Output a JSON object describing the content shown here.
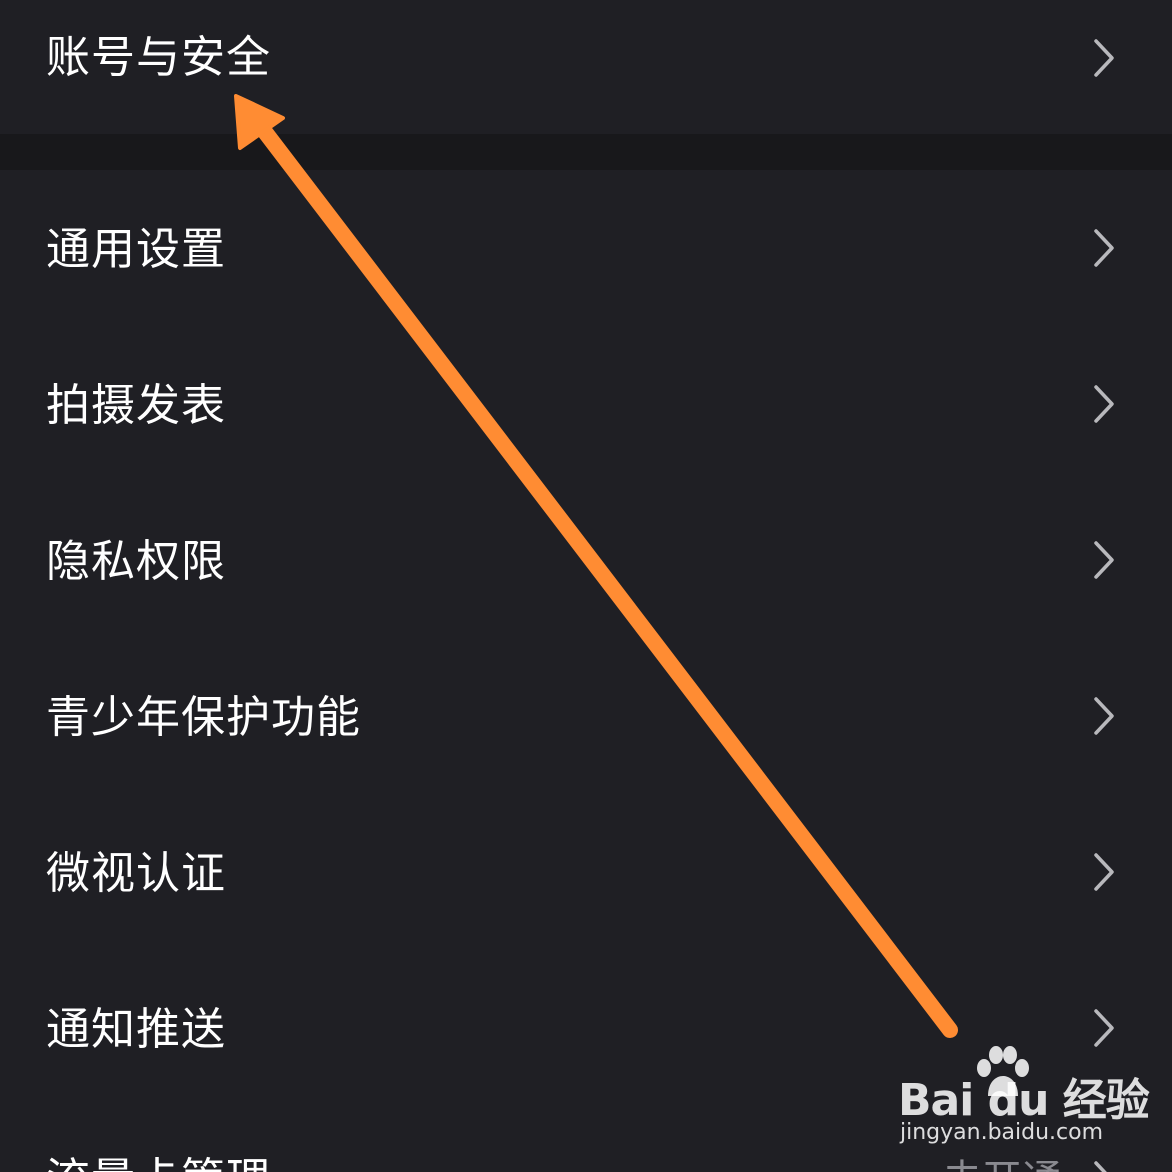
{
  "settings": {
    "items": [
      {
        "label": "账号与安全",
        "value": ""
      },
      {
        "label": "通用设置",
        "value": ""
      },
      {
        "label": "拍摄发表",
        "value": ""
      },
      {
        "label": "隐私权限",
        "value": ""
      },
      {
        "label": "青少年保护功能",
        "value": ""
      },
      {
        "label": "微视认证",
        "value": ""
      },
      {
        "label": "通知推送",
        "value": ""
      },
      {
        "label": "流量卡管理",
        "value": "未开通"
      }
    ]
  },
  "watermark": {
    "logo": "Bai du 经验",
    "url": "jingyan.baidu.com"
  },
  "colors": {
    "background": "#1f1f24",
    "section_gap": "#18181b",
    "text": "#ffffff",
    "chevron": "#b8b8bc",
    "annotation_arrow": "#ff8c33"
  },
  "icons": {
    "row_chevron": "chevron-right-icon",
    "annotation": "arrow-up-left-icon",
    "watermark_mark": "baidu-paw-icon"
  }
}
